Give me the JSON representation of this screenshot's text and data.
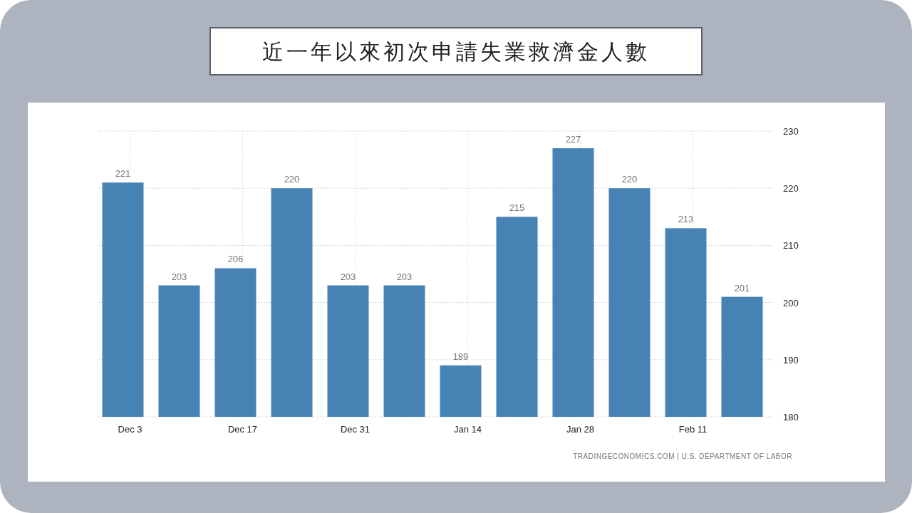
{
  "title": "近一年以來初次申請失業救濟金人數",
  "chart": {
    "source": "TRADINGECONOMICS.COM | U.S. DEPARTMENT OF LABOR",
    "chart_data": {
      "type": "bar",
      "categories": [
        "Dec 3",
        null,
        "Dec 17",
        null,
        "Dec 31",
        null,
        "Jan 14",
        null,
        "Jan 28",
        null,
        "Feb 11",
        null
      ],
      "values": [
        221,
        203,
        206,
        220,
        203,
        203,
        189,
        215,
        227,
        220,
        213,
        201
      ],
      "ylim": [
        180,
        230
      ],
      "yticks": [
        180,
        190,
        200,
        210,
        220,
        230
      ],
      "grid": true,
      "data_labels": true
    }
  }
}
